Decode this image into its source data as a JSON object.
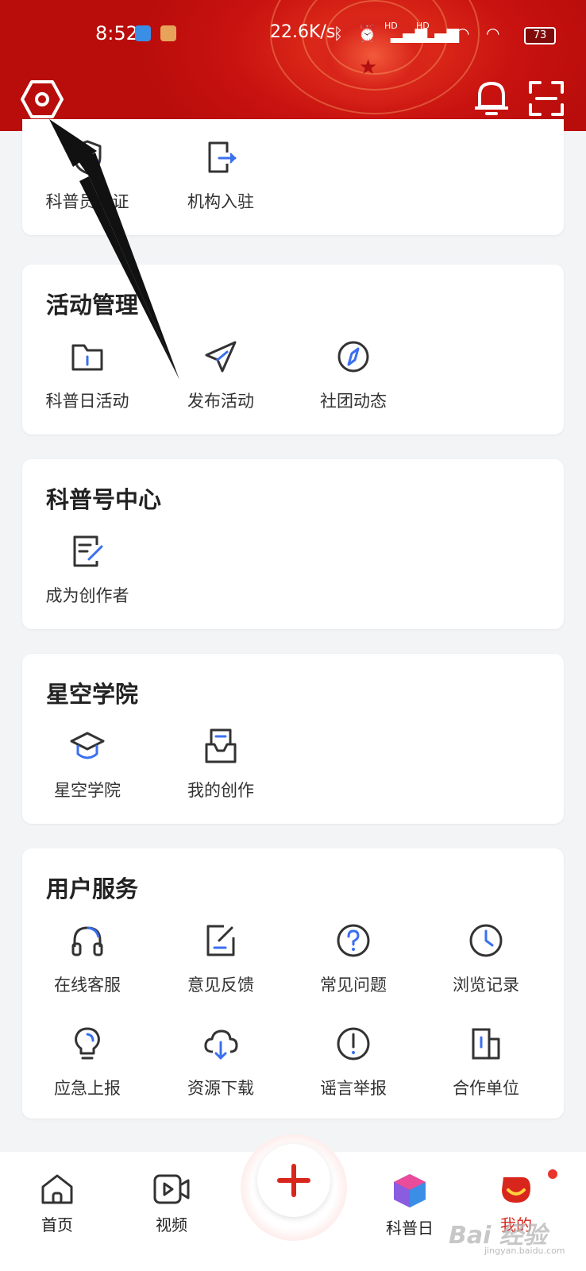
{
  "status_bar": {
    "time": "8:52",
    "network_speed": "22.6K/s",
    "battery": "73",
    "signal_label_1": "HD",
    "signal_label_2": "HD"
  },
  "header": {
    "settings_icon": "settings-hexagon-icon",
    "bell_icon": "bell-icon",
    "scan_icon": "scan-icon",
    "accent_color": "#d9261c"
  },
  "sections": {
    "top": {
      "items": [
        {
          "label": "科普员认证",
          "icon": "shield-user-icon"
        },
        {
          "label": "机构入驻",
          "icon": "document-enter-icon"
        }
      ]
    },
    "activity": {
      "title": "活动管理",
      "items": [
        {
          "label": "科普日活动",
          "icon": "folder-icon"
        },
        {
          "label": "发布活动",
          "icon": "paper-plane-icon"
        },
        {
          "label": "社团动态",
          "icon": "compass-icon"
        }
      ]
    },
    "account_center": {
      "title": "科普号中心",
      "items": [
        {
          "label": "成为创作者",
          "icon": "edit-document-icon"
        }
      ]
    },
    "academy": {
      "title": "星空学院",
      "items": [
        {
          "label": "星空学院",
          "icon": "graduation-cap-icon"
        },
        {
          "label": "我的创作",
          "icon": "inbox-icon"
        }
      ]
    },
    "user_service": {
      "title": "用户服务",
      "items": [
        {
          "label": "在线客服",
          "icon": "headset-icon"
        },
        {
          "label": "意见反馈",
          "icon": "feedback-icon"
        },
        {
          "label": "常见问题",
          "icon": "question-icon"
        },
        {
          "label": "浏览记录",
          "icon": "clock-icon"
        },
        {
          "label": "应急上报",
          "icon": "lightbulb-icon"
        },
        {
          "label": "资源下载",
          "icon": "cloud-download-icon"
        },
        {
          "label": "谣言举报",
          "icon": "exclamation-icon"
        },
        {
          "label": "合作单位",
          "icon": "building-icon"
        }
      ]
    }
  },
  "bottom_nav": {
    "items": [
      {
        "label": "首页",
        "icon": "home-icon"
      },
      {
        "label": "视频",
        "icon": "video-icon"
      },
      {
        "label": "",
        "icon": "plus-icon"
      },
      {
        "label": "科普日",
        "icon": "cube-logo-icon"
      },
      {
        "label": "我的",
        "icon": "profile-mascot-icon"
      }
    ]
  },
  "watermark": {
    "text": "Bai 经验",
    "sub": "jingyan.baidu.com"
  }
}
